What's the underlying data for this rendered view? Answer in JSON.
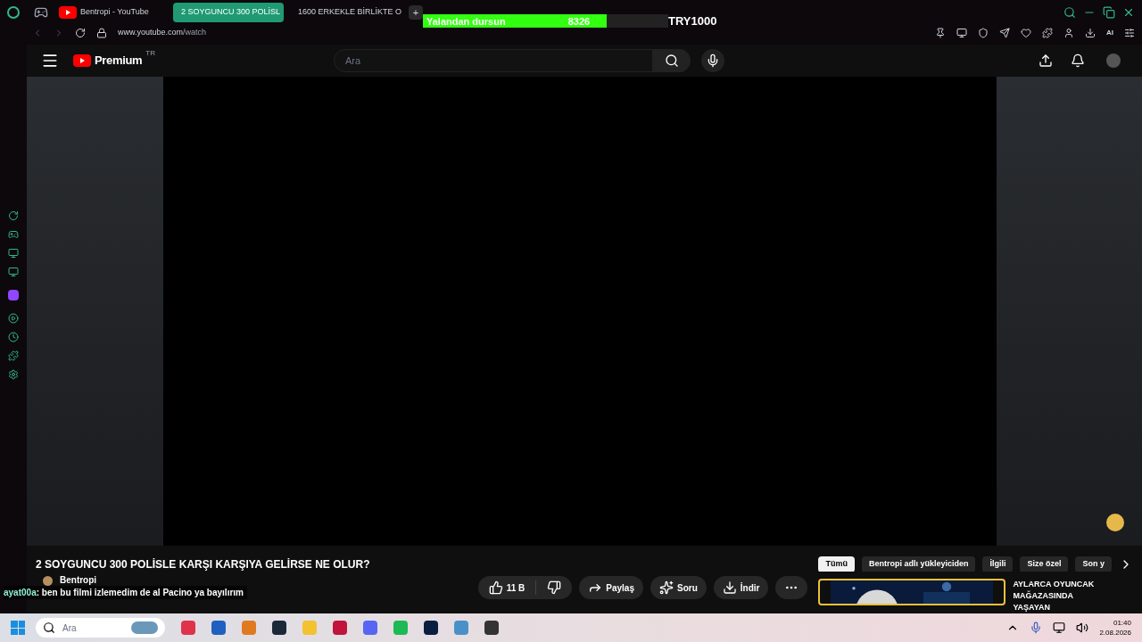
{
  "browser": {
    "tabs": [
      {
        "title": "Bentropi - YouTube",
        "selected": false
      },
      {
        "title": "2 SOYGUNCU 300 POLİSL",
        "selected": true
      },
      {
        "title": "1600 ERKEKLE BİRLİKTE O",
        "selected": false
      }
    ],
    "new_tab": "+",
    "url_host": "www.youtube.com",
    "url_path": "/watch",
    "ai_label": "AI"
  },
  "overlay": {
    "goal_label": "Yalandan dursun",
    "goal_count": "8326",
    "goal_bar": {
      "level": 0.75
    },
    "goal_target": "TRY1000"
  },
  "youtube": {
    "logo": "Premium",
    "region": "TR",
    "search": {
      "placeholder": "Ara"
    },
    "video_title": "2 SOYGUNCU 300 POLİSLE KARŞI KARŞIYA GELİRSE NE OLUR?",
    "channel": "Bentropi",
    "actions": [
      {
        "kind": "like",
        "label": "11 B"
      },
      {
        "kind": "share",
        "label": "Paylaş"
      },
      {
        "kind": "ask",
        "label": "Soru"
      },
      {
        "kind": "download",
        "label": "İndir"
      },
      {
        "kind": "more"
      }
    ],
    "chips": [
      {
        "label": "Tümü",
        "selected": true
      },
      {
        "label": "Bentropi adlı yükleyiciden",
        "selected": false
      },
      {
        "label": "İlgili",
        "selected": false
      },
      {
        "label": "Size özel",
        "selected": false
      },
      {
        "label": "Son y",
        "selected": false
      }
    ],
    "recommended": {
      "kind": "picture",
      "title": "AYLARCA OYUNCAK MAĞAZASINDA YAŞAYAN"
    }
  },
  "chat": {
    "user": "ayat00a",
    "message": ": ben bu filmi izlemedim de al Pacino ya bayılırım"
  },
  "taskbar": {
    "search_placeholder": "Ara",
    "time": "01:40",
    "date": "2.08.2026"
  }
}
